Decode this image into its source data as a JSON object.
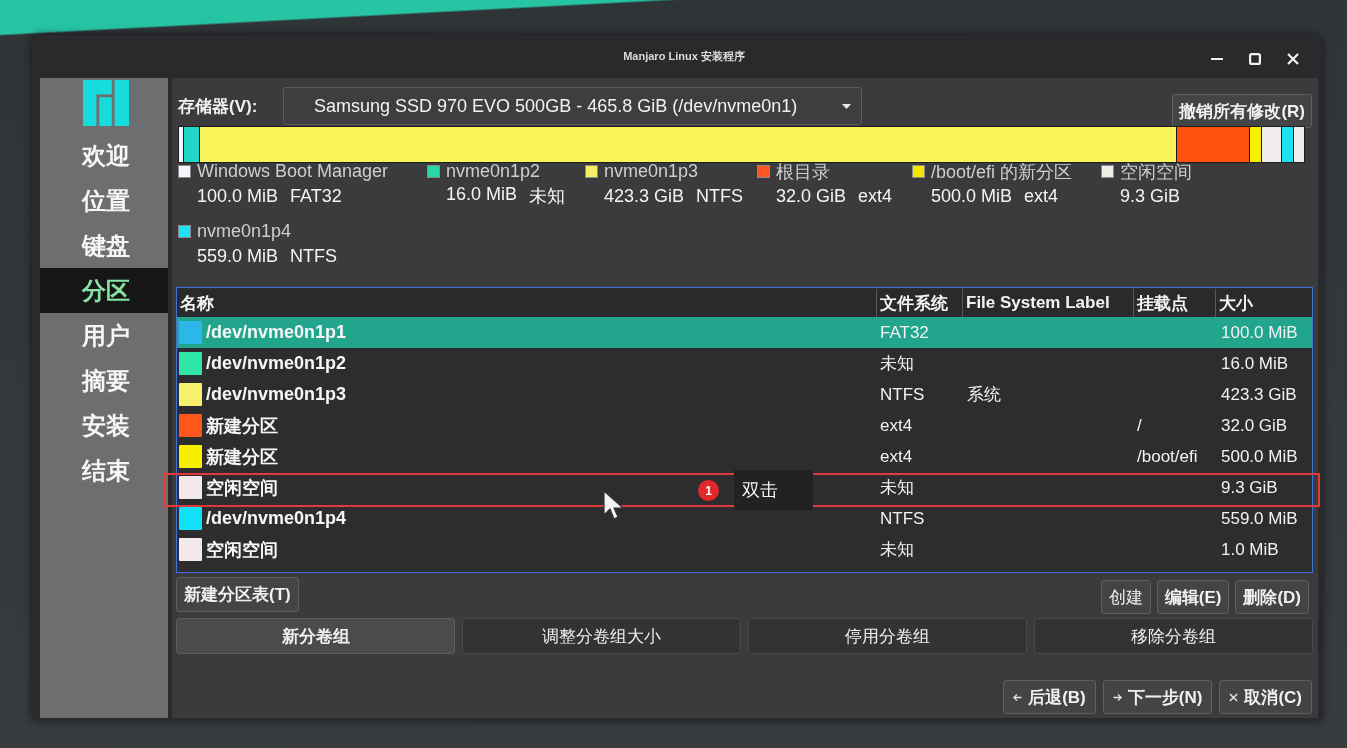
{
  "window": {
    "title": "Manjaro Linux 安装程序"
  },
  "sidebar": {
    "items": [
      {
        "label": "欢迎",
        "selected": false
      },
      {
        "label": "位置",
        "selected": false
      },
      {
        "label": "键盘",
        "selected": false
      },
      {
        "label": "分区",
        "selected": true
      },
      {
        "label": "用户",
        "selected": false
      },
      {
        "label": "摘要",
        "selected": false
      },
      {
        "label": "安装",
        "selected": false
      },
      {
        "label": "结束",
        "selected": false
      }
    ]
  },
  "storage": {
    "label": "存储器(V):",
    "device": "Samsung SSD 970 EVO 500GB - 465.8 GiB (/dev/nvme0n1)",
    "revert_button": "撤销所有修改(R)"
  },
  "usage_bar": [
    {
      "color": "#f4f6fa"
    },
    {
      "color": "#22d6c8"
    },
    {
      "color": "#f8f45a"
    },
    {
      "color": "#ff5010"
    },
    {
      "color": "#f8f000"
    },
    {
      "color": "#f0ecec"
    },
    {
      "color": "#20e0f0"
    },
    {
      "color": "#f0ecec"
    }
  ],
  "legend": [
    {
      "name": "Windows Boot Manager",
      "color": "#f4f6fa",
      "size": "100.0 MiB",
      "filesystem": "FAT32"
    },
    {
      "name": "nvme0n1p2",
      "color": "#27d9a6",
      "size": "16.0 MiB",
      "filesystem": "未知"
    },
    {
      "name": "nvme0n1p3",
      "color": "#f5ef68",
      "size": "423.3 GiB",
      "filesystem": "NTFS"
    },
    {
      "name": "根目录",
      "color": "#ff5520",
      "size": "32.0 GiB",
      "filesystem": "ext4"
    },
    {
      "name": "/boot/efi 的新分区",
      "color": "#f5e800",
      "size": "500.0 MiB",
      "filesystem": "ext4"
    },
    {
      "name": "空闲空间",
      "color": "#f0ece8",
      "size": "9.3 GiB"
    },
    {
      "name": "nvme0n1p4",
      "color": "#19e3f4",
      "size": "559.0 MiB",
      "filesystem": "NTFS"
    }
  ],
  "table": {
    "columns": [
      "名称",
      "文件系统",
      "File System Label",
      "挂载点",
      "大小"
    ],
    "rows": [
      {
        "color": "#2bb8e8",
        "name": "/dev/nvme0n1p1",
        "filesystem": "FAT32",
        "size": "100.0 MiB",
        "selected": true,
        "highlighted": false
      },
      {
        "color": "#2ee6a6",
        "name": "/dev/nvme0n1p2",
        "filesystem": "未知",
        "size": "16.0 MiB",
        "selected": false,
        "highlighted": false
      },
      {
        "color": "#f6f06c",
        "name": "/dev/nvme0n1p3",
        "filesystem": "NTFS",
        "label": "系统",
        "size": "423.3 GiB",
        "selected": false,
        "highlighted": false
      },
      {
        "color": "#ff561c",
        "name": "新建分区",
        "filesystem": "ext4",
        "mount": "/",
        "size": "32.0 GiB",
        "selected": false,
        "highlighted": false
      },
      {
        "color": "#f8ee00",
        "name": "新建分区",
        "filesystem": "ext4",
        "mount": "/boot/efi",
        "size": "500.0 MiB",
        "selected": false,
        "highlighted": false
      },
      {
        "color": "#f2e8ee",
        "name": "空闲空间",
        "filesystem": "未知",
        "size": "9.3 GiB",
        "selected": false,
        "highlighted": true
      },
      {
        "color": "#12e0f6",
        "name": "/dev/nvme0n1p4",
        "filesystem": "NTFS",
        "size": "559.0 MiB",
        "selected": false,
        "highlighted": false
      },
      {
        "color": "#f2e8ee",
        "name": "空闲空间",
        "filesystem": "未知",
        "size": "1.0 MiB",
        "selected": false,
        "highlighted": false
      }
    ]
  },
  "annotation": {
    "number": "1",
    "text": "双击"
  },
  "partition_actions": {
    "new_table": "新建分区表(T)",
    "buttons": [
      "创建",
      "编辑(E)",
      "删除(D)"
    ]
  },
  "volume_groups": [
    {
      "label": "新分卷组",
      "disabled": false
    },
    {
      "label": "调整分卷组大小",
      "disabled": true
    },
    {
      "label": "停用分卷组",
      "disabled": true
    },
    {
      "label": "移除分卷组",
      "disabled": true
    }
  ],
  "navigation": [
    {
      "kind": "back",
      "label": "后退(B)"
    },
    {
      "kind": "next",
      "label": "下一步(N)"
    },
    {
      "kind": "cancel",
      "label": "取消(C)"
    }
  ]
}
